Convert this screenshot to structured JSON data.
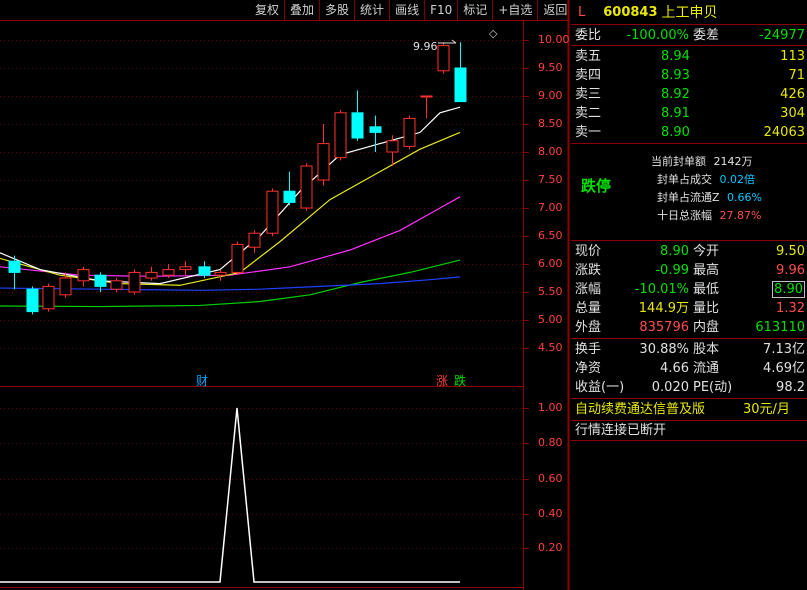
{
  "toolbar": {
    "buttons": [
      "复权",
      "叠加",
      "多股",
      "统计",
      "画线",
      "F10",
      "标记",
      "+自选",
      "返回"
    ]
  },
  "price_axis": {
    "labels": [
      "10.00",
      "9.50",
      "9.00",
      "8.50",
      "8.00",
      "7.50",
      "7.00",
      "6.50",
      "6.00",
      "5.50",
      "5.00",
      "4.50"
    ]
  },
  "indicator_axis": {
    "labels": [
      "1.00",
      "0.80",
      "0.60",
      "0.40",
      "0.20"
    ]
  },
  "chart_markers": {
    "high_label": "9.96",
    "cai": "财",
    "zhang": "涨",
    "die": "跌"
  },
  "stock": {
    "flag": "L",
    "code": "600843",
    "name": "上工申贝"
  },
  "order_ratio": {
    "wb_label": "委比",
    "wb_value": "-100.00%",
    "wc_label": "委差",
    "wc_value": "-24977"
  },
  "asks": [
    {
      "label": "卖五",
      "price": "8.94",
      "vol": "113"
    },
    {
      "label": "卖四",
      "price": "8.93",
      "vol": "71"
    },
    {
      "label": "卖三",
      "price": "8.92",
      "vol": "426"
    },
    {
      "label": "卖二",
      "price": "8.91",
      "vol": "304"
    },
    {
      "label": "卖一",
      "price": "8.90",
      "vol": "24063"
    }
  ],
  "limit_info": {
    "status": "跌停",
    "seal_amount_label": "当前封单额",
    "seal_amount": "2142万",
    "seal_turnover_label": "封单占成交",
    "seal_turnover": "0.02倍",
    "seal_float_label": "封单占流通Z",
    "seal_float": "0.66%",
    "ten_day_label": "十日总涨幅",
    "ten_day": "27.87%"
  },
  "quote": {
    "price_label": "现价",
    "price": "8.90",
    "open_label": "今开",
    "open": "9.50",
    "chg_label": "涨跌",
    "chg": "-0.99",
    "high_label": "最高",
    "high": "9.96",
    "pct_label": "涨幅",
    "pct": "-10.01%",
    "low_label": "最低",
    "low": "8.90",
    "vol_label": "总量",
    "vol": "144.9万",
    "vr_label": "量比",
    "vr": "1.32",
    "outer_label": "外盘",
    "outer": "835796",
    "inner_label": "内盘",
    "inner": "613110"
  },
  "fundamentals": {
    "turnover_label": "换手",
    "turnover": "30.88%",
    "equity_label": "股本",
    "equity": "7.13亿",
    "nav_label": "净资",
    "nav": "4.66",
    "float_label": "流通",
    "float": "4.69亿",
    "eps_label": "收益(一)",
    "eps": "0.020",
    "pe_label": "PE(动)",
    "pe": "98.2"
  },
  "promo": {
    "text": "自动续费通达信普及版",
    "price": "30元/月"
  },
  "connection": {
    "status": "行情连接已断开"
  }
}
